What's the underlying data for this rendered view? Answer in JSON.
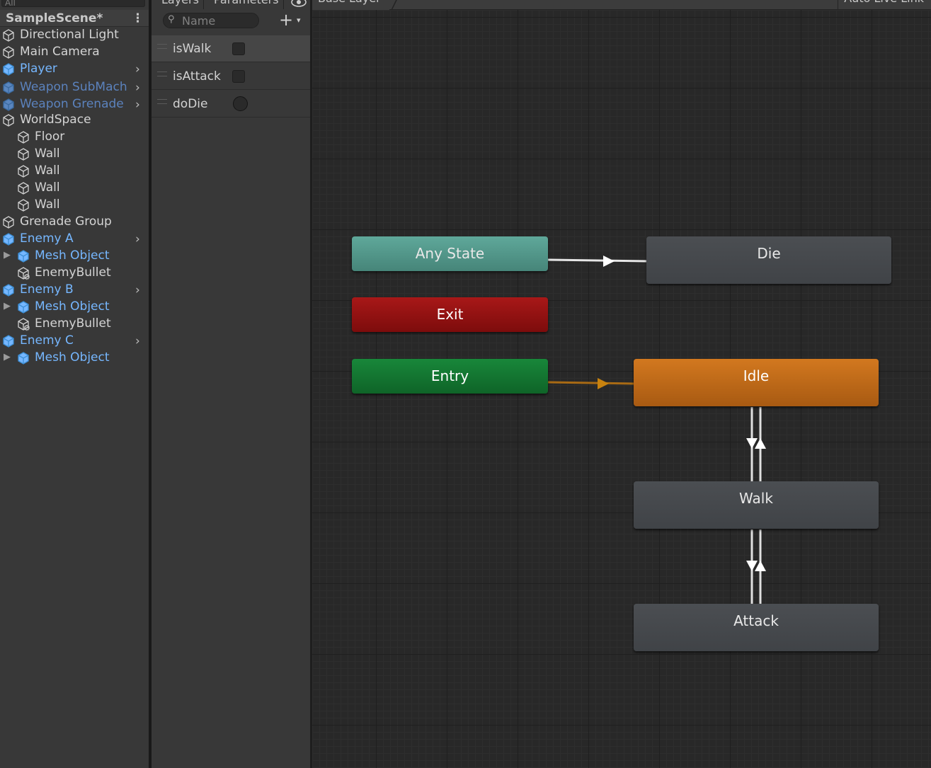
{
  "hierarchy": {
    "search_placeholder": "All",
    "scene_title": "SampleScene*",
    "scene_menu": "⋮",
    "items": [
      {
        "label": "Directional Light",
        "style": "normal"
      },
      {
        "label": "Main Camera",
        "style": "normal"
      },
      {
        "label": "Player",
        "style": "prefab"
      },
      {
        "label": "Weapon SubMach",
        "style": "faded"
      },
      {
        "label": "Weapon Grenade",
        "style": "faded"
      },
      {
        "label": "WorldSpace",
        "style": "normal"
      },
      {
        "label": "Floor",
        "style": "normal"
      },
      {
        "label": "Wall",
        "style": "normal"
      },
      {
        "label": "Wall",
        "style": "normal"
      },
      {
        "label": "Wall",
        "style": "normal"
      },
      {
        "label": "Wall",
        "style": "normal"
      },
      {
        "label": "Grenade Group",
        "style": "normal"
      },
      {
        "label": "Enemy A",
        "style": "prefab"
      },
      {
        "label": "Mesh Object",
        "style": "prefab"
      },
      {
        "label": "EnemyBullet",
        "style": "normal"
      },
      {
        "label": "Enemy B",
        "style": "prefab"
      },
      {
        "label": "Mesh Object",
        "style": "prefab"
      },
      {
        "label": "EnemyBullet",
        "style": "normal"
      },
      {
        "label": "Enemy C",
        "style": "prefab"
      },
      {
        "label": "Mesh Object",
        "style": "prefab"
      }
    ]
  },
  "animator": {
    "tabs": {
      "layers": "Layers",
      "parameters": "Parameters"
    },
    "search_placeholder": "Name",
    "add_button": "+",
    "add_dropdown": "▾",
    "parameters": [
      {
        "name": "isWalk",
        "type": "bool",
        "value": false
      },
      {
        "name": "isAttack",
        "type": "bool",
        "value": false
      },
      {
        "name": "doDie",
        "type": "trigger",
        "value": false
      }
    ],
    "breadcrumb": "Base Layer",
    "live_link": "Auto Live Link",
    "states": {
      "any_state": "Any State",
      "exit": "Exit",
      "entry": "Entry",
      "die": "Die",
      "idle": "Idle",
      "walk": "Walk",
      "attack": "Attack"
    },
    "default_state": "Idle",
    "colors": {
      "any_state": "#5fa89a",
      "exit": "#a81818",
      "entry": "#18873a",
      "default_state": "#d2781f",
      "state": "#4b4e52",
      "prefab_text": "#76b7ff",
      "selected_text_faded": "#5b82bd"
    }
  }
}
